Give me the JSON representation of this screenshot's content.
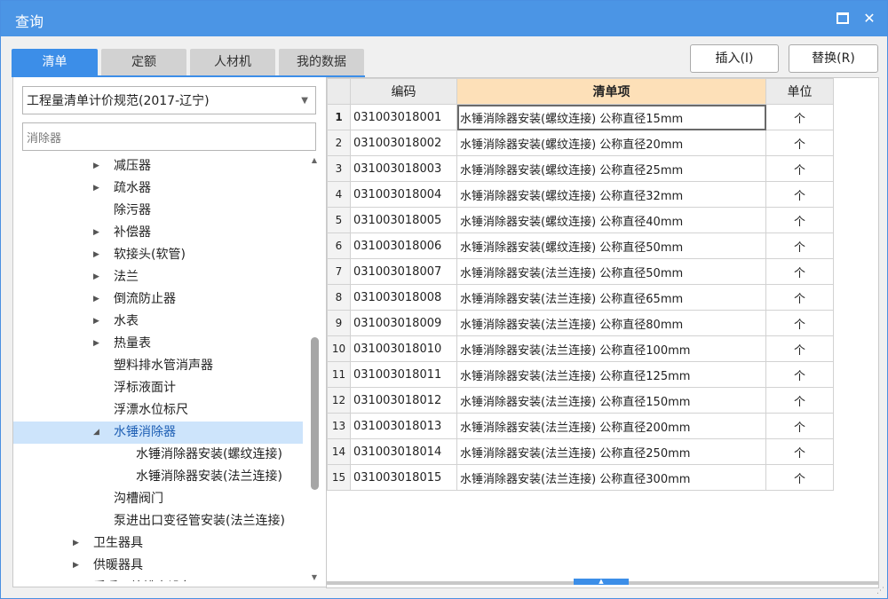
{
  "window": {
    "title": "查询"
  },
  "tabs": [
    {
      "label": "清单",
      "active": true
    },
    {
      "label": "定额",
      "active": false
    },
    {
      "label": "人材机",
      "active": false
    },
    {
      "label": "我的数据",
      "active": false
    }
  ],
  "buttons": {
    "insert": "插入(I)",
    "replace": "替换(R)"
  },
  "standard_select": {
    "value": "工程量清单计价规范(2017-辽宁)"
  },
  "search": {
    "value": "消除器"
  },
  "tree": [
    {
      "label": "减压器",
      "expand": "collapsed",
      "level": 2
    },
    {
      "label": "疏水器",
      "expand": "collapsed",
      "level": 2
    },
    {
      "label": "除污器",
      "expand": "none",
      "level": 2
    },
    {
      "label": "补偿器",
      "expand": "collapsed",
      "level": 2
    },
    {
      "label": "软接头(软管)",
      "expand": "collapsed",
      "level": 2
    },
    {
      "label": "法兰",
      "expand": "collapsed",
      "level": 2
    },
    {
      "label": "倒流防止器",
      "expand": "collapsed",
      "level": 2
    },
    {
      "label": "水表",
      "expand": "collapsed",
      "level": 2
    },
    {
      "label": "热量表",
      "expand": "collapsed",
      "level": 2
    },
    {
      "label": "塑料排水管消声器",
      "expand": "none",
      "level": 2
    },
    {
      "label": "浮标液面计",
      "expand": "none",
      "level": 2
    },
    {
      "label": "浮漂水位标尺",
      "expand": "none",
      "level": 2
    },
    {
      "label": "水锤消除器",
      "expand": "expanded",
      "level": 2,
      "selected": true
    },
    {
      "label": "水锤消除器安装(螺纹连接)",
      "expand": "none",
      "level": 3
    },
    {
      "label": "水锤消除器安装(法兰连接)",
      "expand": "none",
      "level": 3
    },
    {
      "label": "沟槽阀门",
      "expand": "none",
      "level": 2
    },
    {
      "label": "泵进出口变径管安装(法兰连接)",
      "expand": "none",
      "level": 2
    },
    {
      "label": "卫生器具",
      "expand": "collapsed",
      "level": 1
    },
    {
      "label": "供暖器具",
      "expand": "collapsed",
      "level": 1
    },
    {
      "label": "采暖、给排水设备",
      "expand": "collapsed",
      "level": 1
    }
  ],
  "table": {
    "headers": {
      "code": "编码",
      "item": "清单项",
      "unit": "单位"
    },
    "rows": [
      {
        "n": "1",
        "code": "031003018001",
        "item": "水锤消除器安装(螺纹连接) 公称直径15mm",
        "unit": "个"
      },
      {
        "n": "2",
        "code": "031003018002",
        "item": "水锤消除器安装(螺纹连接) 公称直径20mm",
        "unit": "个"
      },
      {
        "n": "3",
        "code": "031003018003",
        "item": "水锤消除器安装(螺纹连接) 公称直径25mm",
        "unit": "个"
      },
      {
        "n": "4",
        "code": "031003018004",
        "item": "水锤消除器安装(螺纹连接) 公称直径32mm",
        "unit": "个"
      },
      {
        "n": "5",
        "code": "031003018005",
        "item": "水锤消除器安装(螺纹连接) 公称直径40mm",
        "unit": "个"
      },
      {
        "n": "6",
        "code": "031003018006",
        "item": "水锤消除器安装(螺纹连接) 公称直径50mm",
        "unit": "个"
      },
      {
        "n": "7",
        "code": "031003018007",
        "item": "水锤消除器安装(法兰连接) 公称直径50mm",
        "unit": "个"
      },
      {
        "n": "8",
        "code": "031003018008",
        "item": "水锤消除器安装(法兰连接) 公称直径65mm",
        "unit": "个"
      },
      {
        "n": "9",
        "code": "031003018009",
        "item": "水锤消除器安装(法兰连接) 公称直径80mm",
        "unit": "个"
      },
      {
        "n": "10",
        "code": "031003018010",
        "item": "水锤消除器安装(法兰连接) 公称直径100mm",
        "unit": "个"
      },
      {
        "n": "11",
        "code": "031003018011",
        "item": "水锤消除器安装(法兰连接) 公称直径125mm",
        "unit": "个"
      },
      {
        "n": "12",
        "code": "031003018012",
        "item": "水锤消除器安装(法兰连接) 公称直径150mm",
        "unit": "个"
      },
      {
        "n": "13",
        "code": "031003018013",
        "item": "水锤消除器安装(法兰连接) 公称直径200mm",
        "unit": "个"
      },
      {
        "n": "14",
        "code": "031003018014",
        "item": "水锤消除器安装(法兰连接) 公称直径250mm",
        "unit": "个"
      },
      {
        "n": "15",
        "code": "031003018015",
        "item": "水锤消除器安装(法兰连接) 公称直径300mm",
        "unit": "个"
      }
    ]
  },
  "colors": {
    "accent": "#3c8ee8",
    "title_bar": "#4b95e5",
    "selection": "#cde4fb",
    "highlight_header": "#fde0b8"
  },
  "icons": {
    "maximize": "maximize-icon",
    "close": "close-icon",
    "dropdown": "chevron-down-icon"
  }
}
